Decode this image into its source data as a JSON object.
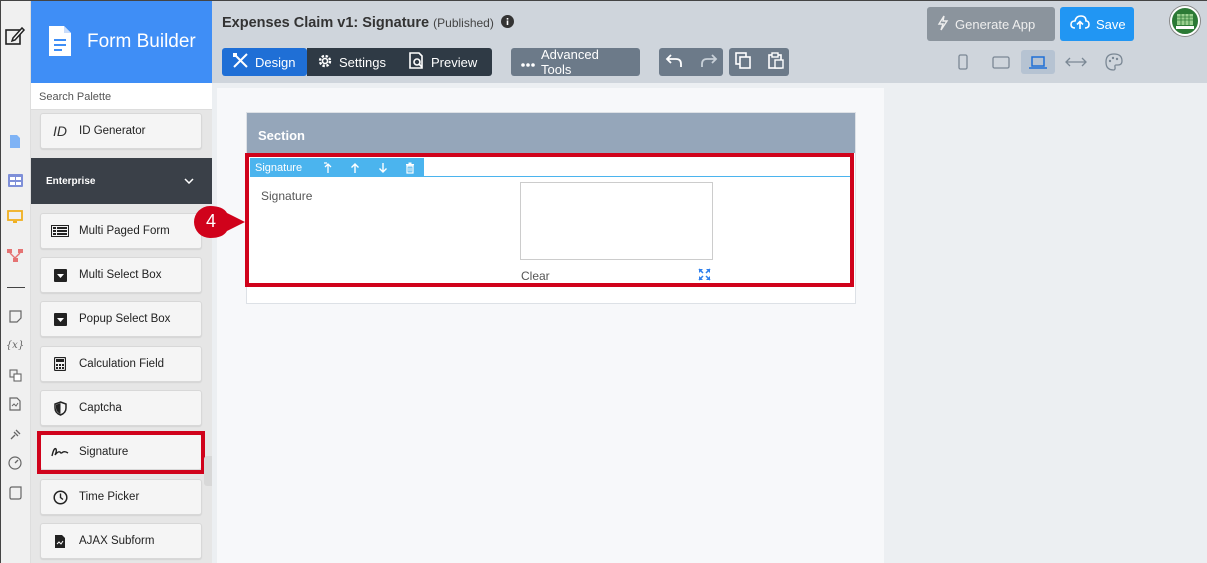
{
  "palette": {
    "title": "Form Builder",
    "search_placeholder": "Search Palette",
    "top_item": {
      "label": "ID Generator",
      "icon": "id-icon"
    },
    "group_label": "Enterprise",
    "items": [
      {
        "label": "Multi Paged Form",
        "icon": "multi-page-icon"
      },
      {
        "label": "Multi Select Box",
        "icon": "dropdown-icon"
      },
      {
        "label": "Popup Select Box",
        "icon": "dropdown-icon"
      },
      {
        "label": "Calculation Field",
        "icon": "calculator-icon"
      },
      {
        "label": "Captcha",
        "icon": "shield-icon"
      },
      {
        "label": "Signature",
        "icon": "signature-icon",
        "highlighted": true
      },
      {
        "label": "Time Picker",
        "icon": "clock-icon"
      },
      {
        "label": "AJAX Subform",
        "icon": "document-icon"
      }
    ]
  },
  "header": {
    "title": "Expenses Claim v1: Signature",
    "status": "(Published)",
    "tabs": [
      {
        "label": "Design",
        "active": true
      },
      {
        "label": "Settings",
        "active": false
      },
      {
        "label": "Preview",
        "active": false
      }
    ],
    "advanced_tools_label": "Advanced Tools",
    "generate_app_label": "Generate App",
    "save_label": "Save"
  },
  "form": {
    "section_title": "Section",
    "selected_field_type": "Signature",
    "field_label": "Signature",
    "clear_label": "Clear",
    "callout_number": "4"
  },
  "colors": {
    "brand_blue": "#3f8ef6",
    "highlight_red": "#d0021b",
    "field_bar_blue": "#4bb4ee",
    "section_header": "#95a6ba"
  }
}
